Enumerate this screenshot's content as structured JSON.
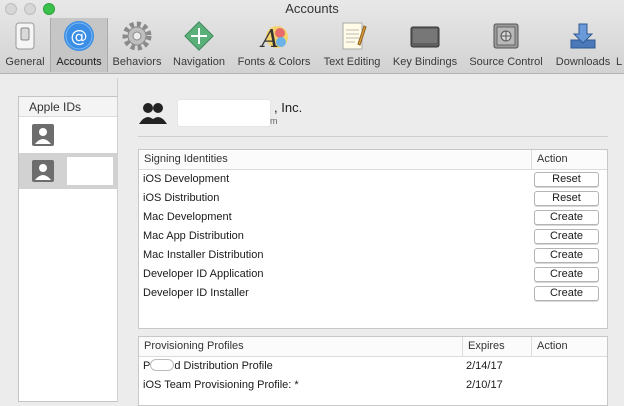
{
  "window": {
    "title": "Accounts"
  },
  "toolbar": {
    "items": [
      {
        "label": "General",
        "icon": "switch-icon"
      },
      {
        "label": "Accounts",
        "icon": "at-sign-icon",
        "selected": true
      },
      {
        "label": "Behaviors",
        "icon": "gear-icon"
      },
      {
        "label": "Navigation",
        "icon": "compass-icon"
      },
      {
        "label": "Fonts & Colors",
        "icon": "font-palette-icon"
      },
      {
        "label": "Text Editing",
        "icon": "notepad-icon"
      },
      {
        "label": "Key Bindings",
        "icon": "keyboard-key-icon"
      },
      {
        "label": "Source Control",
        "icon": "safe-icon"
      },
      {
        "label": "Downloads",
        "icon": "download-tray-icon"
      },
      {
        "label": "L"
      }
    ]
  },
  "sidebar": {
    "heading": "Apple IDs",
    "accounts": [
      {
        "redacted": true,
        "selected": false
      },
      {
        "redacted": true,
        "selected": true
      }
    ]
  },
  "team": {
    "name_suffix": ", Inc.",
    "subtitle": "m"
  },
  "signing": {
    "headers": {
      "name": "Signing Identities",
      "action": "Action"
    },
    "rows": [
      {
        "name": "iOS Development",
        "action": "Reset"
      },
      {
        "name": "iOS Distribution",
        "action": "Reset"
      },
      {
        "name": "Mac Development",
        "action": "Create"
      },
      {
        "name": "Mac App Distribution",
        "action": "Create"
      },
      {
        "name": "Mac Installer Distribution",
        "action": "Create"
      },
      {
        "name": "Developer ID Application",
        "action": "Create"
      },
      {
        "name": "Developer ID Installer",
        "action": "Create"
      }
    ]
  },
  "profiles": {
    "headers": {
      "name": "Provisioning Profiles",
      "expires": "Expires",
      "action": "Action"
    },
    "rows": [
      {
        "prefix": "P",
        "name": "d Distribution Profile",
        "expires": "2/14/17"
      },
      {
        "prefix": "",
        "name": "iOS Team Provisioning Profile: *",
        "expires": "2/10/17"
      }
    ]
  },
  "colors": {
    "accent": "#3a8ee6",
    "selection_gray": "#c6c6c6",
    "close_green": "#3ac14a"
  }
}
